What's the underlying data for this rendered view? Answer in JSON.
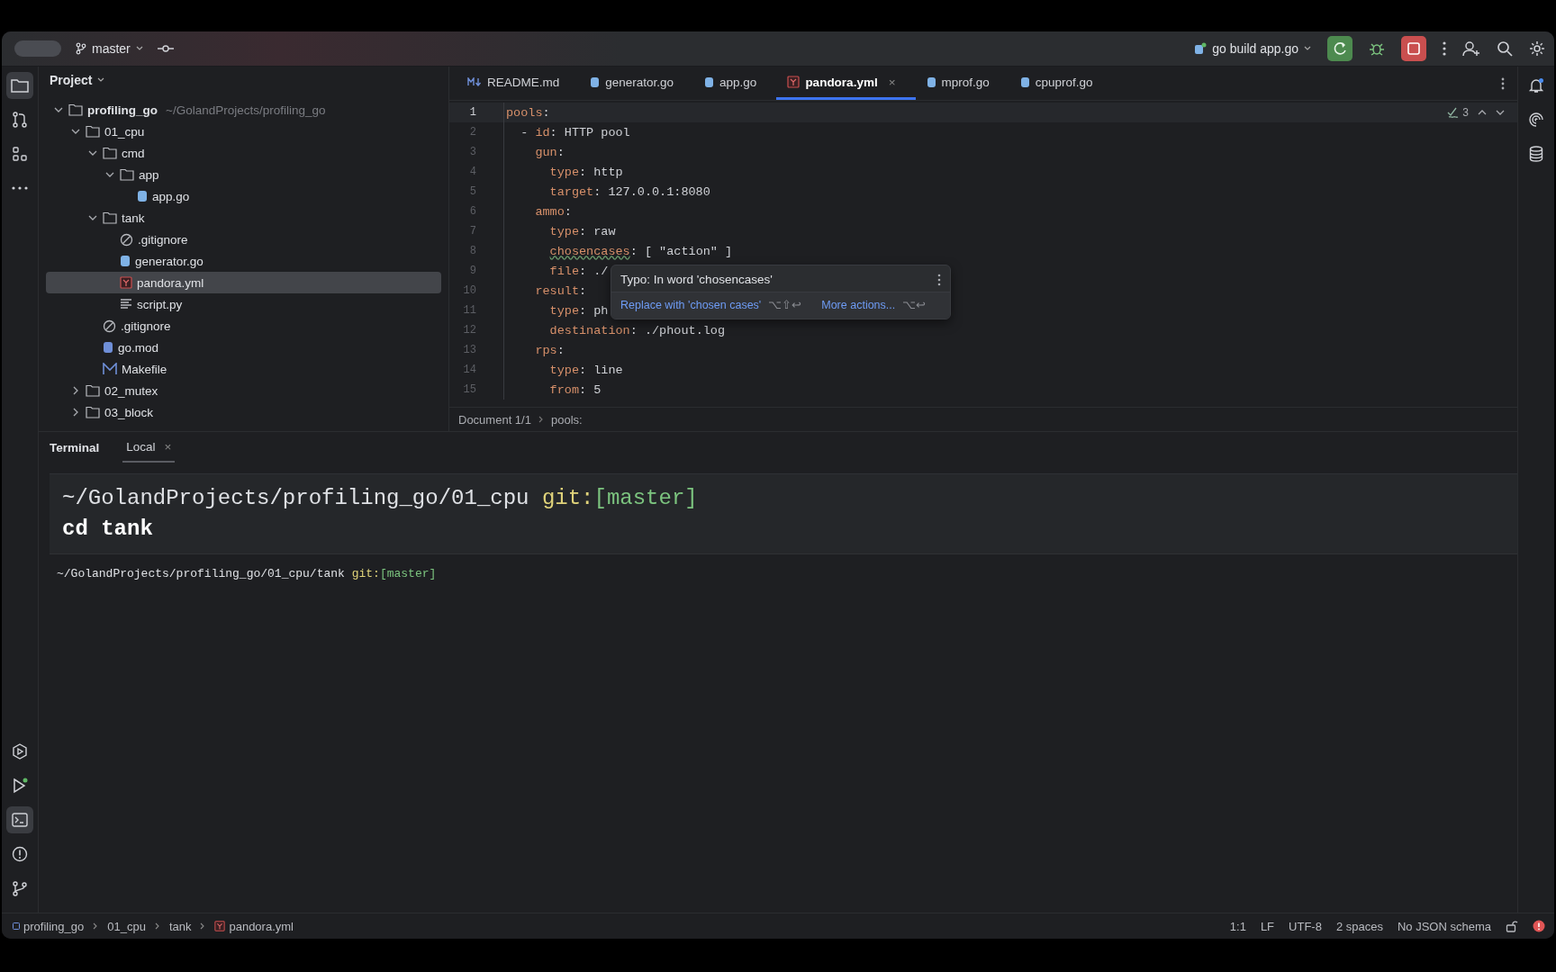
{
  "title_bar": {
    "branch": "master",
    "run_config": "go build app.go"
  },
  "left_tools": [
    {
      "kind": "folder",
      "selected": true
    },
    {
      "kind": "pull",
      "selected": false
    },
    {
      "kind": "structure",
      "selected": false
    },
    {
      "kind": "more",
      "selected": false
    }
  ],
  "left_tools_bottom": [
    {
      "kind": "services",
      "selected": false
    },
    {
      "kind": "run",
      "selected": false
    },
    {
      "kind": "terminal",
      "selected": true
    },
    {
      "kind": "problems",
      "selected": false
    },
    {
      "kind": "git",
      "selected": false
    }
  ],
  "project": {
    "title": "Project",
    "tree": [
      {
        "name": "profiling_go",
        "hint": "~/GolandProjects/profiling_go",
        "kind": "folder",
        "expanded": true,
        "selected": false,
        "children": [
          {
            "name": "01_cpu",
            "kind": "folder",
            "expanded": true,
            "selected": false,
            "children": [
              {
                "name": "cmd",
                "kind": "folder",
                "expanded": true,
                "selected": false,
                "children": [
                  {
                    "name": "app",
                    "kind": "folder",
                    "expanded": true,
                    "selected": false,
                    "children": [
                      {
                        "name": "app.go",
                        "kind": "go",
                        "selected": false
                      }
                    ]
                  }
                ]
              },
              {
                "name": "tank",
                "kind": "folder",
                "expanded": true,
                "selected": false,
                "children": [
                  {
                    "name": ".gitignore",
                    "kind": "ignore",
                    "selected": false
                  },
                  {
                    "name": "generator.go",
                    "kind": "go",
                    "selected": false
                  },
                  {
                    "name": "pandora.yml",
                    "kind": "yml",
                    "selected": true
                  },
                  {
                    "name": "script.py",
                    "kind": "text",
                    "selected": false
                  }
                ]
              },
              {
                "name": ".gitignore",
                "kind": "ignore",
                "selected": false
              },
              {
                "name": "go.mod",
                "kind": "mod",
                "selected": false
              },
              {
                "name": "Makefile",
                "kind": "make",
                "selected": false
              }
            ]
          },
          {
            "name": "02_mutex",
            "kind": "folder",
            "expanded": false,
            "selected": false
          },
          {
            "name": "03_block",
            "kind": "folder",
            "expanded": false,
            "selected": false
          }
        ]
      }
    ]
  },
  "tabs": [
    {
      "label": "README.md",
      "kind": "md",
      "selected": false
    },
    {
      "label": "generator.go",
      "kind": "go",
      "selected": false
    },
    {
      "label": "app.go",
      "kind": "go",
      "selected": false
    },
    {
      "label": "pandora.yml",
      "kind": "yml",
      "selected": true,
      "close": "×"
    },
    {
      "label": "mprof.go",
      "kind": "go",
      "selected": false
    },
    {
      "label": "cpuprof.go",
      "kind": "go",
      "selected": false
    }
  ],
  "inspections": {
    "count": "3"
  },
  "code": [
    {
      "num": "1",
      "key": "pools",
      "sep": ":",
      "children": [
        {
          "num": "2",
          "dash": "-",
          "key": "id",
          "sep": ":",
          "value": "HTTP pool"
        },
        {
          "num": "3",
          "key": "gun",
          "sep": ":",
          "children": [
            {
              "num": "4",
              "key": "type",
              "sep": ":",
              "value": "http"
            },
            {
              "num": "5",
              "key": "target",
              "sep": ":",
              "value": "127.0.0.1:8080"
            }
          ]
        },
        {
          "num": "6",
          "key": "ammo",
          "sep": ":",
          "children": [
            {
              "num": "7",
              "key": "type",
              "sep": ":",
              "value": "raw"
            },
            {
              "num": "8",
              "key": "chosencases",
              "sep": ":",
              "value": "[ \"action\" ]",
              "typo": true
            },
            {
              "num": "9",
              "key": "file",
              "sep": ":",
              "value": "./"
            }
          ]
        },
        {
          "num": "10",
          "key": "result",
          "sep": ":",
          "children": [
            {
              "num": "11",
              "key": "type",
              "sep": ":",
              "value": "ph"
            },
            {
              "num": "12",
              "key": "destination",
              "sep": ":",
              "value": "./phout.log"
            }
          ]
        },
        {
          "num": "13",
          "key": "rps",
          "sep": ":",
          "children": [
            {
              "num": "14",
              "key": "type",
              "sep": ":",
              "value": "line"
            },
            {
              "num": "15",
              "key": "from",
              "sep": ":",
              "value": "5"
            }
          ]
        }
      ]
    }
  ],
  "popup": {
    "title": "Typo: In word 'chosencases'",
    "actions": [
      {
        "label": "Replace with 'chosen cases'",
        "shortcut": "⌥⇧↩"
      },
      {
        "label": "More actions...",
        "shortcut": "⌥↩"
      }
    ]
  },
  "editor_breadcrumb": [
    "Document 1/1",
    "pools:"
  ],
  "terminal": {
    "title": "Terminal",
    "tabs": [
      {
        "label": "Local",
        "selected": true,
        "close": "×"
      }
    ],
    "block": {
      "path": "~/GolandProjects/profiling_go/01_cpu",
      "git": "git:",
      "branch": "[master]",
      "command": "cd tank"
    },
    "prompt": {
      "path": "~/GolandProjects/profiling_go/01_cpu/tank",
      "git": "git:",
      "branch": "[master]"
    }
  },
  "status_bar": {
    "breadcrumb": [
      {
        "label": "profiling_go",
        "kind": "module"
      },
      {
        "label": "01_cpu",
        "kind": "folder"
      },
      {
        "label": "tank",
        "kind": "folder"
      },
      {
        "label": "pandora.yml",
        "kind": "yml"
      }
    ],
    "items": [
      "1:1",
      "LF",
      "UTF-8",
      "2 spaces",
      "No JSON schema"
    ]
  }
}
